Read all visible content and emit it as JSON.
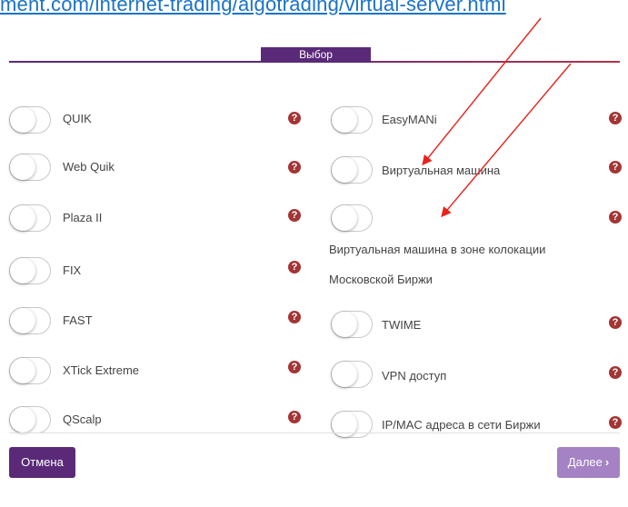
{
  "header": {
    "url_text": "ment.com/internet-trading/algotrading/virtual-server.html",
    "section_title": "Выбор"
  },
  "left_options": [
    {
      "label": "QUIK",
      "help": "?"
    },
    {
      "label": "Web Quik",
      "help": "?"
    },
    {
      "label": "Plaza II",
      "help": "?"
    },
    {
      "label": "FIX",
      "help": "?"
    },
    {
      "label": "FAST",
      "help": "?"
    },
    {
      "label": "XTick Extreme",
      "help": "?"
    },
    {
      "label": "QScalp",
      "help": "?"
    }
  ],
  "right_options": [
    {
      "label": "EasyMANi",
      "help": "?"
    },
    {
      "label": "Виртуальная машина",
      "help": "?"
    },
    {
      "label": "",
      "help": "?",
      "description_lines": [
        "Виртуальная машина в зоне колокации",
        "Московской Биржи"
      ]
    },
    {
      "label": "TWIME",
      "help": "?"
    },
    {
      "label": "VPN доступ",
      "help": "?"
    },
    {
      "label": "IP/MAC адреса в сети Биржи",
      "help": "?"
    }
  ],
  "footer": {
    "cancel_label": "Отмена",
    "next_label": "Далее",
    "next_icon": "chevron-right-icon"
  },
  "colors": {
    "brand_purple": "#5a2a78",
    "help_red": "#a33535",
    "next_button": "#a482c4",
    "annotation_arrow": "#e8231c",
    "link_blue": "#1a73c8"
  }
}
